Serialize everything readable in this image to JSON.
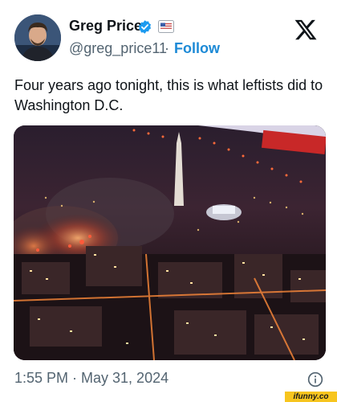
{
  "author": {
    "name": "Greg Price",
    "handle": "@greg_price11",
    "follow_label": "Follow",
    "separator": "·"
  },
  "icons": {
    "verified": "verified-badge-icon",
    "flag": "us-flag-icon",
    "platform": "x-logo-icon",
    "info": "info-icon"
  },
  "tweet": {
    "text": "Four years ago tonight, this is what leftists did to Washington D.C.",
    "timestamp": "1:55 PM · May 31, 2024"
  },
  "watermark": {
    "text": "ifunny.co"
  },
  "colors": {
    "link": "#1d8ad6",
    "verified": "#1d9bf0",
    "text": "#0f1419",
    "muted": "#536471",
    "watermark_bg": "#f7c51e"
  }
}
